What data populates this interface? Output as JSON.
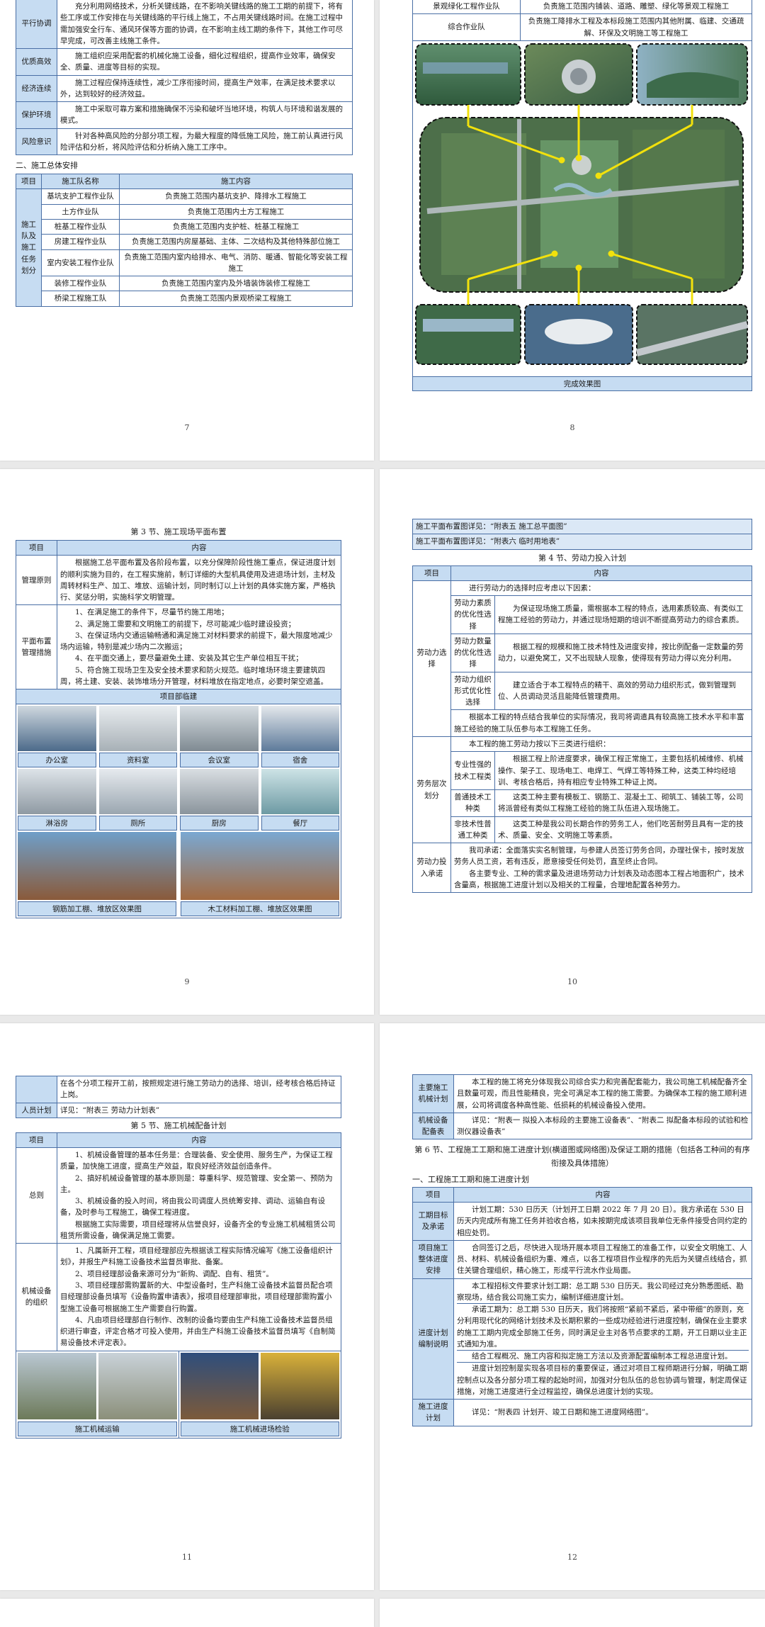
{
  "p7": {
    "rows_top": [
      {
        "label": "平行协调",
        "text": "充分利用网络技术，分析关键线路，在不影响关键线路的施工工期的前提下，将有些工序或工作安排在与关键线路的平行线上施工，不占用关键线路时间。在施工过程中需加强安全行车、通风环保等方面的协调，在不影响主线工期的条件下，其他工作可尽早完成，可改善主线施工条件。"
      },
      {
        "label": "优质高效",
        "text": "施工组织应采用配套的机械化施工设备，细化过程组织，提高作业效率，确保安全、质量、进度等目标的实现。"
      },
      {
        "label": "经济连续",
        "text": "施工过程应保持连续性，减少工序衔接时间，提高生产效率，在满足技术要求以外，达到较好的经济效益。"
      },
      {
        "label": "保护环境",
        "text": "施工中采取可靠方案和措施确保不污染和破坏当地环境，构筑人与环境和谐发展的模式。"
      },
      {
        "label": "风险意识",
        "text": "针对各种高风险的分部分项工程，为最大程度的降低施工风险，施工前认真进行风险评估和分析，将风险评估和分析纳入施工工序中。"
      }
    ],
    "section2": "二、施工总体安排",
    "head": [
      "项目",
      "施工队名称",
      "施工内容"
    ],
    "group_label": "施工队及施工任务划分",
    "teams": [
      {
        "name": "基坑支护工程作业队",
        "content": "负责施工范围内基坑支护、降排水工程施工"
      },
      {
        "name": "土方作业队",
        "content": "负责施工范围内土方工程施工"
      },
      {
        "name": "桩基工程作业队",
        "content": "负责施工范围内支护桩、桩基工程施工"
      },
      {
        "name": "房建工程作业队",
        "content": "负责施工范围内房屋基础、主体、二次结构及其他特殊部位施工"
      },
      {
        "name": "室内安装工程作业队",
        "content": "负责施工范围内室内给排水、电气、消防、暖通、智能化等安装工程施工"
      },
      {
        "name": "装修工程作业队",
        "content": "负责施工范围内室内及外墙装饰装修工程施工"
      },
      {
        "name": "桥梁工程施工队",
        "content": "负责施工范围内景观桥梁工程施工"
      }
    ],
    "page_number": "7"
  },
  "p8": {
    "rows": [
      {
        "name": "景观绿化工程作业队",
        "content": "负责施工范围内铺装、道路、雕塑、绿化等景观工程施工"
      },
      {
        "name": "综合作业队",
        "content": "负责施工降排水工程及本标段施工范围内其他附属、临建、交通疏解、环保及文明施工等工程施工"
      }
    ],
    "caption": "完成效果图",
    "page_number": "8"
  },
  "p9": {
    "title": "第 3 节、施工现场平面布置",
    "head": [
      "项目",
      "内容"
    ],
    "principle_label": "管理原则",
    "principle_text": "根据施工总平面布置及各阶段布置，以充分保障阶段性施工重点，保证进度计划的顺利实施为目的，在工程实施前，制订详细的大型机具使用及进退场计划，主材及周转材料生产、加工、堆放、运输计划，同时制订以上计划的具体实施方案，严格执行、奖惩分明，实施科学文明管理。",
    "measures_label": "平面布置管理措施",
    "measures": [
      "1、在满足施工的条件下，尽量节约施工用地；",
      "2、满足施工需要和文明施工的前提下，尽可能减少临时建设投资；",
      "3、在保证场内交通运输畅通和满足施工对材料要求的前提下，最大限度地减少场内运输，特别是减少场内二次搬运；",
      "4、在平面交通上，要尽量避免土建、安装及其它生产单位相互干扰；",
      "5、符合施工现场卫生及安全技术要求和防火规范。临时堆场环境主要建筑四周，将土建、安装、装饰堆场分开管理，材料堆放在指定地点，必要时架空遮盖。"
    ],
    "camp_title": "项目部临建",
    "photos_row1": [
      "办公室",
      "资料室",
      "会议室",
      "宿舍"
    ],
    "photos_row2": [
      "淋浴房",
      "厕所",
      "厨房",
      "餐厅"
    ],
    "photos_row3": [
      "钢筋加工棚、堆放区效果图",
      "木工材料加工棚、堆放区效果图"
    ],
    "page_number": "9"
  },
  "p10": {
    "top_rows": [
      "施工平面布置图详见：“附表五 施工总平面图”",
      "施工平面布置图详见：“附表六 临时用地表”"
    ],
    "title": "第 4 节、劳动力投入计划",
    "head": [
      "项目",
      "内容"
    ],
    "select_label": "劳动力选择",
    "select_intro": "进行劳动力的选择时应考虑以下因素：",
    "select_items": [
      {
        "k": "劳动力素质的优化性选择",
        "v": "为保证现场施工质量，需根据本工程的特点，选用素质较高、有类似工程施工经验的劳动力，并通过现场短期的培训不断提高劳动力的综合素质。"
      },
      {
        "k": "劳动力数量的优化性选择",
        "v": "根据工程的规模和施工技术特性及进度安排，按比例配备一定数量的劳动力，以避免窝工，又不出现缺人现象，使得现有劳动力得以充分利用。"
      },
      {
        "k": "劳动力组织形式优化性选择",
        "v": "建立适合于本工程特点的精干、高效的劳动力组织形式，做到管理到位、人员调动灵活且能降低管理费用。"
      }
    ],
    "select_tail": "根据本工程的特点结合我单位的实际情况，我司将调遣具有较高施工技术水平和丰富施工经验的施工队伍参与本工程施工任务。",
    "level_label": "劳务层次划分",
    "level_intro": "本工程的施工劳动力按以下三类进行组织：",
    "level_items": [
      {
        "k": "专业性强的技术工程类",
        "v": "根据工程上阶进度要求，确保工程正常施工，主要包括机械维修、机械操作、架子工、现场电工、电焊工、气焊工等特殊工种，这类工种均经培训、考核合格后，持有相应专业特殊工种证上岗。"
      },
      {
        "k": "普通技术工种类",
        "v": "这类工种主要有模板工、钢筋工、混凝土工、砌筑工、铺装工等，公司将派曾经有类似工程施工经验的施工队伍进入现场施工。"
      },
      {
        "k": "非技术性普通工种类",
        "v": "这类工种是我公司长期合作的劳务工人，他们吃苦耐劳且具有一定的技术、质量、安全、文明施工等素质。"
      }
    ],
    "commit_label": "劳动力投入承诺",
    "commit_text": "我司承诺：全面落实实名制管理，与参建人员签订劳务合同，办理社保卡，按时发放劳务人员工资，若有违反，愿意接受任何处罚，直至终止合同。",
    "commit_text2": "各主要专业、工种的需求量及进退场劳动力计划表及动态图本工程占地面积广，技术含量高，根据施工进度计划以及相关的工程量，合理地配置各种劳力。",
    "page_number": "10"
  },
  "p11": {
    "top_text": "在各个分项工程开工前，按照规定进行施工劳动力的选择、培训，经考核合格后持证上岗。",
    "staff_label": "人员计划",
    "staff_text": "详见：“附表三 劳动力计划表”",
    "title": "第 5 节、施工机械配备计划",
    "head": [
      "项目",
      "内容"
    ],
    "general_label": "总则",
    "general": [
      "1、机械设备管理的基本任务是：合理装备、安全使用、服务生产，为保证工程质量，加快施工进度，提高生产效益，取良好经济效益创造条件。",
      "2、搞好机械设备管理的基本原则是：尊重科学、规范管理、安全第一、预防为主。",
      "3、机械设备的投入时间，将由我公司调度人员统筹安排、调动、运输自有设备，及时参与工程施工，确保工程进度。",
      "根据施工实际需要，项目经理将从信誉良好，设备齐全的专业施工机械租赁公司租赁所需设备，确保满足施工需要。"
    ],
    "org_label": "机械设备的组织",
    "org": [
      "1、凡属新开工程，项目经理部应先根据该工程实际情况编写《施工设备组织计划》，并报生产科施工设备技术监督员审批、备案。",
      "2、项目经理部设备来源可分为“新购、调配、自有、租赁”。",
      "3、项目经理部需购置新的大、中型设备时，生产科施工设备技术监督员配合项目经理部设备员填写《设备购置申请表》，报项目经理部审批，项目经理部需购置小型施工设备可根据施工生产需要自行购置。",
      "4、凡由项目经理部自行制作、改制的设备均要由生产科施工设备技术监督员组织进行审查，评定合格才可投入使用，并由生产科施工设备技术监督员填写《自制简易设备技术评定表》。"
    ],
    "photo_caps": [
      "施工机械运输",
      "施工机械进场检验"
    ],
    "page_number": "11"
  },
  "p12": {
    "rows_top": [
      {
        "label": "主要施工机械计划",
        "text": "本工程的施工将充分体现我公司综合实力和完善配套能力，我公司施工机械配备齐全且数量可观，而且性能精良，完全可满足本工程的施工需要。为确保本工程的施工顺利进展，公司将调度各种高性能、低损耗的机械设备投入使用。"
      },
      {
        "label": "机械设备配备表",
        "text": "详见：“附表一 拟投入本标段的主要施工设备表”、“附表二 拟配备本标段的试验和检测仪器设备表”"
      }
    ],
    "title": "第 6 节、工程施工工期和施工进度计划(横道图或网络图)及保证工期的措施（包括各工种间的有序衔接及具体措施）",
    "sub": "一、工程施工工期和施工进度计划",
    "head": [
      "项目",
      "内容"
    ],
    "rows": [
      {
        "label": "工期目标及承诺",
        "text": "计划工期：530 日历天（计划开工日期 2022 年 7 月 20 日）。我方承诺在 530 日历天内完成所有施工任务并验收合格，如未按期完成该项目我单位无条件接受合同约定的相应处罚。"
      },
      {
        "label": "项目施工整体进度安排",
        "text": "合同签订之后，尽快进入现场开展本项目工程施工的准备工作，以安全文明施工、人员、材料、机械设备组织为重、难点，以各工程项目作业程序的先后为关键点线结合，抓住关键合理组织，精心施工，形成平行流水作业局面。"
      }
    ],
    "plan_label": "进度计划编制说明",
    "plan": [
      "本工程招标文件要求计划工期：总工期 530 日历天。我公司经过充分熟悉图纸、勘察现场，结合我公司施工实力，编制详细进度计划。",
      "承诺工期为：总工期 530 日历天，我们将按照“紧前不紧后，紧中带细”的原则，充分利用现代化的网络计划技术及长期积累的一些成功经验进行进度控制，确保在业主要求的施工工期内完成全部施工任务，同时满足业主对各节点要求的工期，开工日期以业主正式通知为准。",
      "结合工程概况、施工内容和拟定施工方法以及资源配置编制本工程总进度计划。",
      "进度计划控制是实现各项目标的重要保证，通过对项目工程师期进行分解，明确工期控制点以及各分部分项工程的起始时间，加强对分包队伍的总包协调与管理，制定周保证措施，对施工进度进行全过程监控，确保总进度计划的实现。"
    ],
    "sched_label": "施工进度计划",
    "sched_text": "详见：“附表四 计划开、竣工日期和施工进度网络图”。",
    "page_number": "12"
  }
}
